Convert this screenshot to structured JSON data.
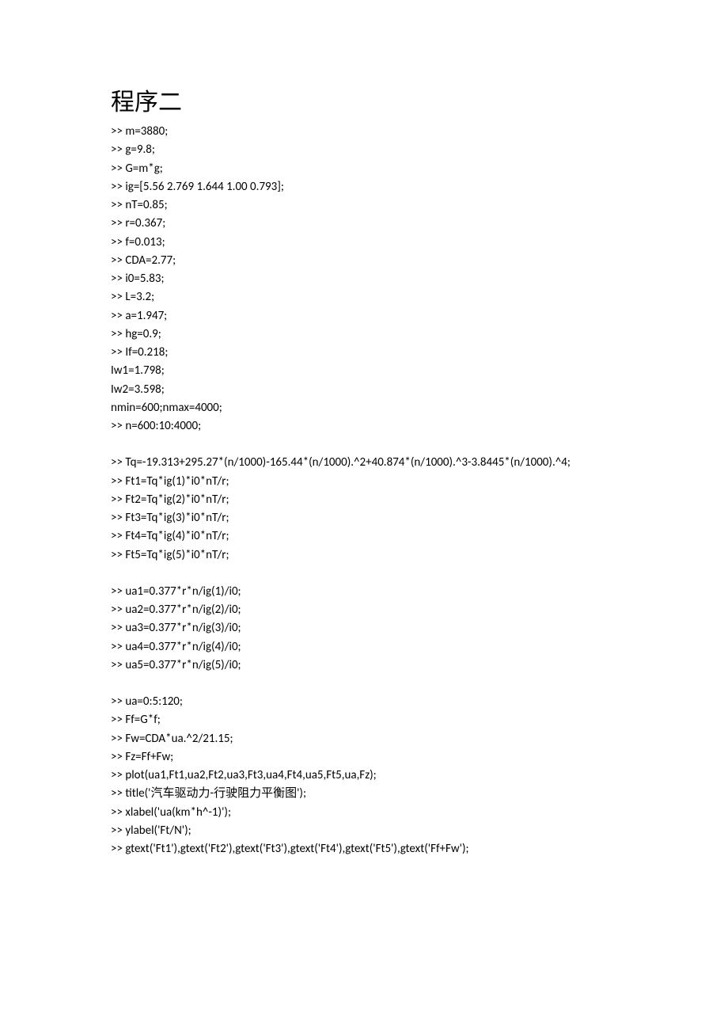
{
  "title": "程序二",
  "lines": [
    ">> m=3880;",
    ">> g=9.8;",
    ">> G=m*g;",
    ">> ig=[5.56 2.769 1.644 1.00 0.793];",
    ">> nT=0.85;",
    ">> r=0.367;",
    ">> f=0.013;",
    ">> CDA=2.77;",
    ">> i0=5.83;",
    ">> L=3.2;",
    ">> a=1.947;",
    ">> hg=0.9;",
    ">> If=0.218;",
    "Iw1=1.798;",
    "Iw2=3.598;",
    "nmin=600;nmax=4000;",
    ">> n=600:10:4000;",
    "",
    ">> Tq=-19.313+295.27*(n/1000)-165.44*(n/1000).^2+40.874*(n/1000).^3-3.8445*(n/1000).^4;",
    ">> Ft1=Tq*ig(1)*i0*nT/r;",
    ">> Ft2=Tq*ig(2)*i0*nT/r;",
    ">> Ft3=Tq*ig(3)*i0*nT/r;",
    ">> Ft4=Tq*ig(4)*i0*nT/r;",
    ">> Ft5=Tq*ig(5)*i0*nT/r;",
    "",
    ">> ua1=0.377*r*n/ig(1)/i0;",
    ">> ua2=0.377*r*n/ig(2)/i0;",
    ">> ua3=0.377*r*n/ig(3)/i0;",
    ">> ua4=0.377*r*n/ig(4)/i0;",
    ">> ua5=0.377*r*n/ig(5)/i0;",
    "",
    ">> ua=0:5:120;",
    ">> Ff=G*f;",
    ">> Fw=CDA*ua.^2/21.15;",
    ">> Fz=Ff+Fw;",
    ">> plot(ua1,Ft1,ua2,Ft2,ua3,Ft3,ua4,Ft4,ua5,Ft5,ua,Fz);",
    ">> title('汽车驱动力-行驶阻力平衡图');",
    ">> xlabel('ua(km*h^-1)');",
    ">> ylabel('Ft/N');",
    ">> gtext('Ft1'),gtext('Ft2'),gtext('Ft3'),gtext('Ft4'),gtext('Ft5'),gtext('Ff+Fw');"
  ]
}
